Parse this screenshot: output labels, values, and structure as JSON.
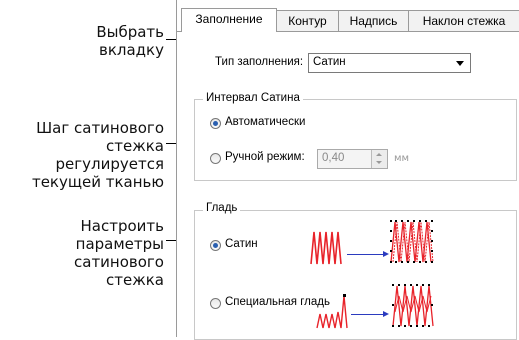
{
  "callouts": {
    "select_tab": [
      "Выбрать",
      "вкладку"
    ],
    "stitch_spacing": [
      "Шаг сатинового",
      "стежка",
      "регулируется",
      "текущей тканью"
    ],
    "satin_params": [
      "Настроить",
      "параметры",
      "сатинового",
      "стежка"
    ]
  },
  "tabs": [
    "Заполнение",
    "Контур",
    "Надпись",
    "Наклон стежка"
  ],
  "fill_type": {
    "label": "Тип заполнения:",
    "value": "Сатин"
  },
  "spacing_group": {
    "title": "Интервал Сатина",
    "auto_label": "Автоматически",
    "manual_label": "Ручной режим:",
    "manual_value": "0,40",
    "unit": "мм",
    "selected": "auto"
  },
  "satin_group": {
    "title": "Гладь",
    "satin_label": "Сатин",
    "special_label": "Специальная гладь",
    "selected": "satin"
  },
  "colors": {
    "stitch_red": "#e8232a",
    "arrow_blue": "#2b3bbf",
    "group_border": "#c8c8c8"
  }
}
